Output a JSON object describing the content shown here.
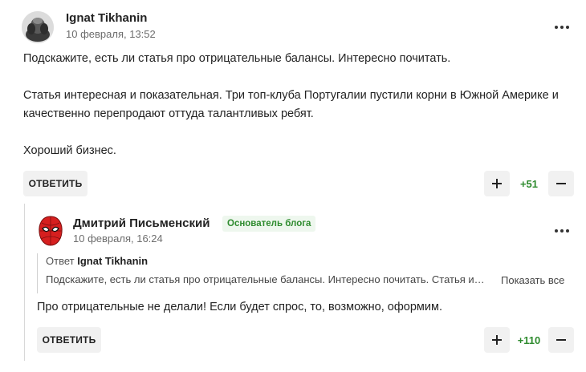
{
  "comments": [
    {
      "author": "Ignat Tikhanin",
      "date": "10 февраля, 13:52",
      "avatar_icon": "user-photo-avatar",
      "text": "Подскажите, есть ли статья про отрицательные балансы. Интересно почитать.\n\nСтатья интересная и показательная. Три топ-клуба Португалии пустили корни в Южной Америке и качественно перепродают оттуда талантливых ребят.\n\nХороший бизнес.",
      "reply_label": "ОТВЕТИТЬ",
      "score": "+51"
    }
  ],
  "reply": {
    "author": "Дмитрий Письменский",
    "badge": "Основатель блога",
    "date": "10 февраля, 16:24",
    "avatar_icon": "spiderman-mask-avatar",
    "quote_prefix": "Ответ",
    "quote_author": "Ignat Tikhanin",
    "quote_text": "Подскажите, есть ли статья про отрицательные балансы. Интересно почитать. Статья интересная и показательная.",
    "show_all_label": "Показать все",
    "text": "Про отрицательные не делали! Если будет спрос, то, возможно, оформим.",
    "reply_label": "ОТВЕТИТЬ",
    "score": "+110"
  },
  "colors": {
    "score_green": "#2e8b2e",
    "badge_bg": "#eef7ee",
    "button_bg": "#f1f1f1"
  }
}
